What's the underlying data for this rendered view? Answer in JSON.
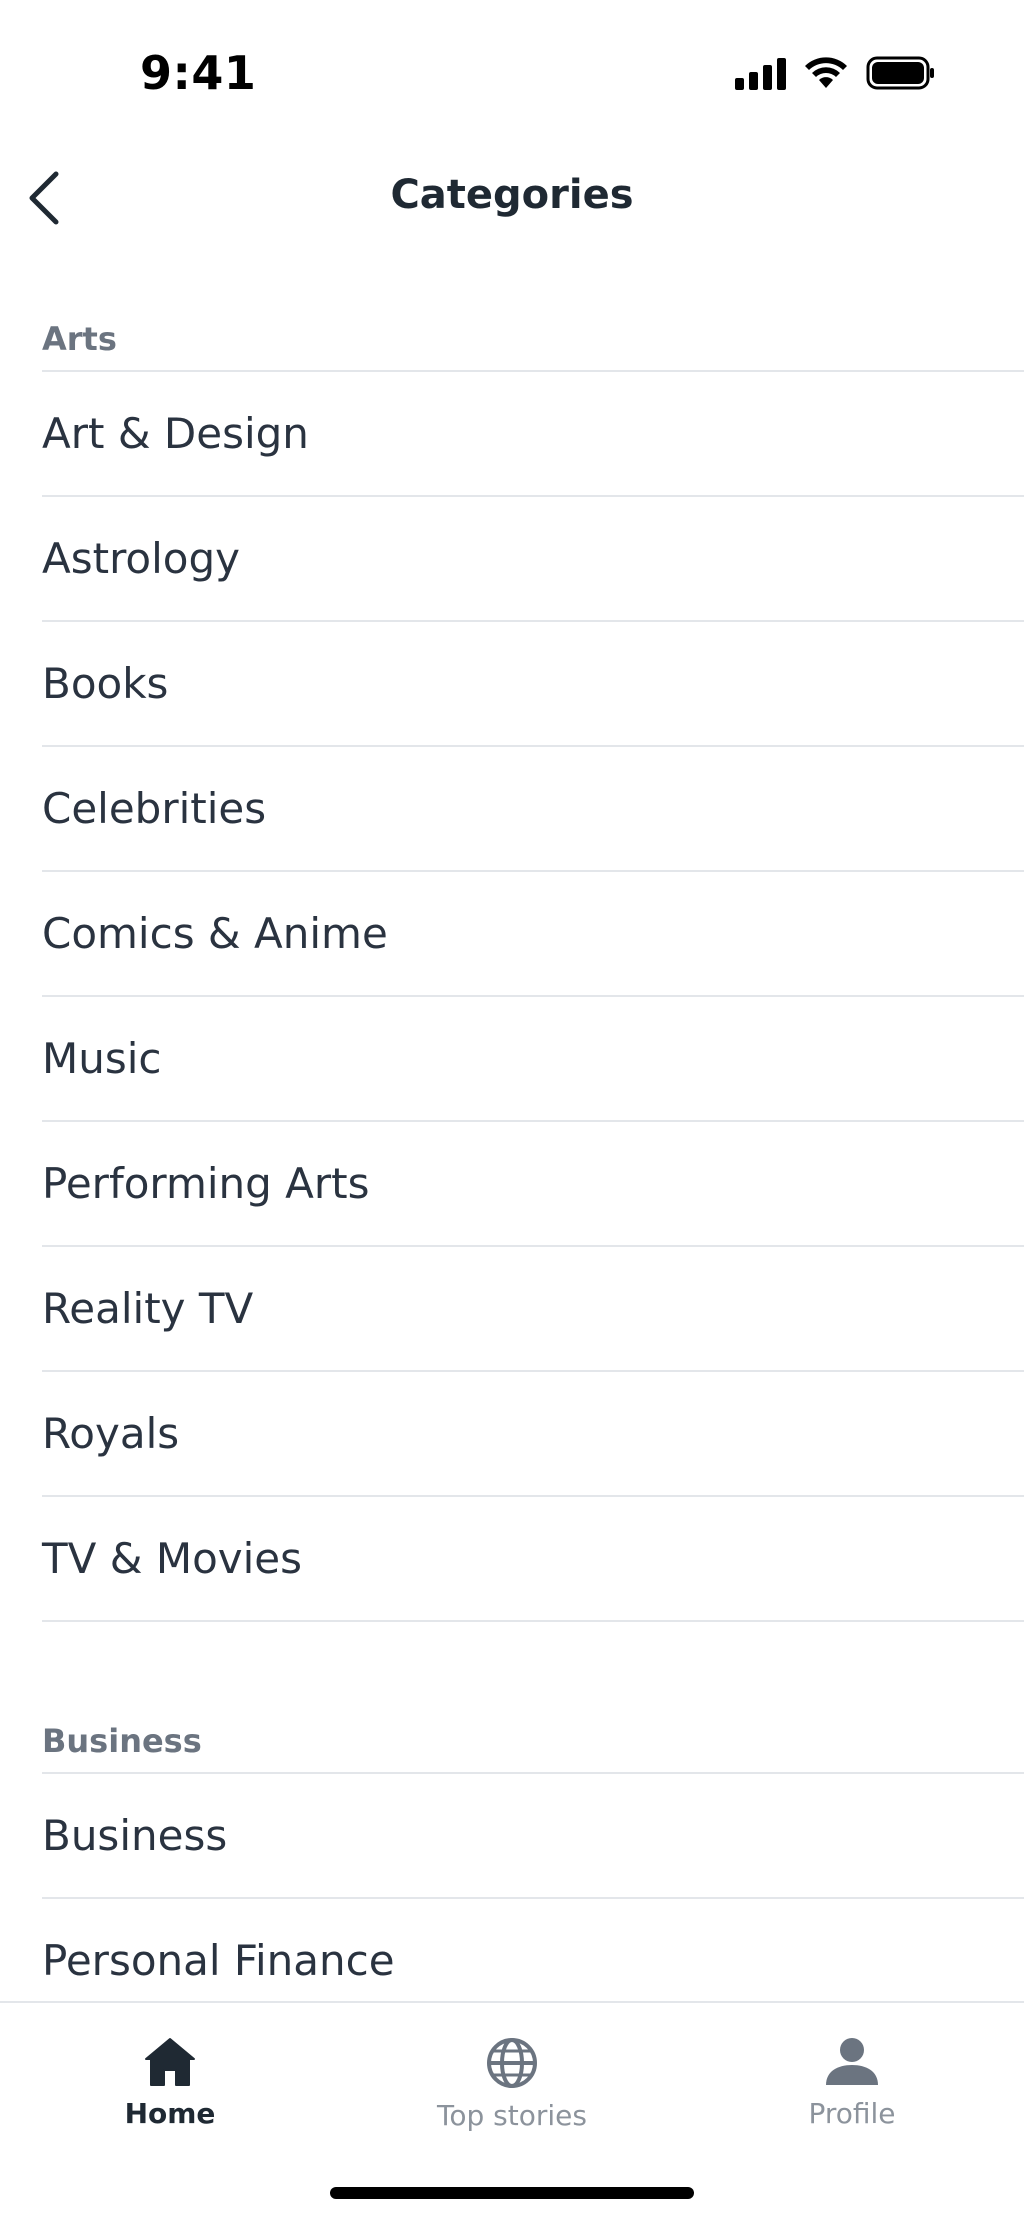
{
  "status_bar": {
    "time": "9:41"
  },
  "header": {
    "title": "Categories"
  },
  "sections": [
    {
      "header": "Arts",
      "items": [
        "Art & Design",
        "Astrology",
        "Books",
        "Celebrities",
        "Comics & Anime",
        "Music",
        "Performing Arts",
        "Reality TV",
        "Royals",
        "TV & Movies"
      ]
    },
    {
      "header": "Business",
      "items": [
        "Business",
        "Personal Finance"
      ]
    }
  ],
  "tab_bar": {
    "tabs": [
      {
        "label": "Home",
        "icon": "home-icon",
        "active": true
      },
      {
        "label": "Top stories",
        "icon": "globe-icon",
        "active": false
      },
      {
        "label": "Profile",
        "icon": "profile-icon",
        "active": false
      }
    ]
  },
  "colors": {
    "text_primary": "#1f2933",
    "text_secondary": "#6b7480",
    "divider": "#e3e6ea",
    "tab_inactive": "#8c939c"
  }
}
